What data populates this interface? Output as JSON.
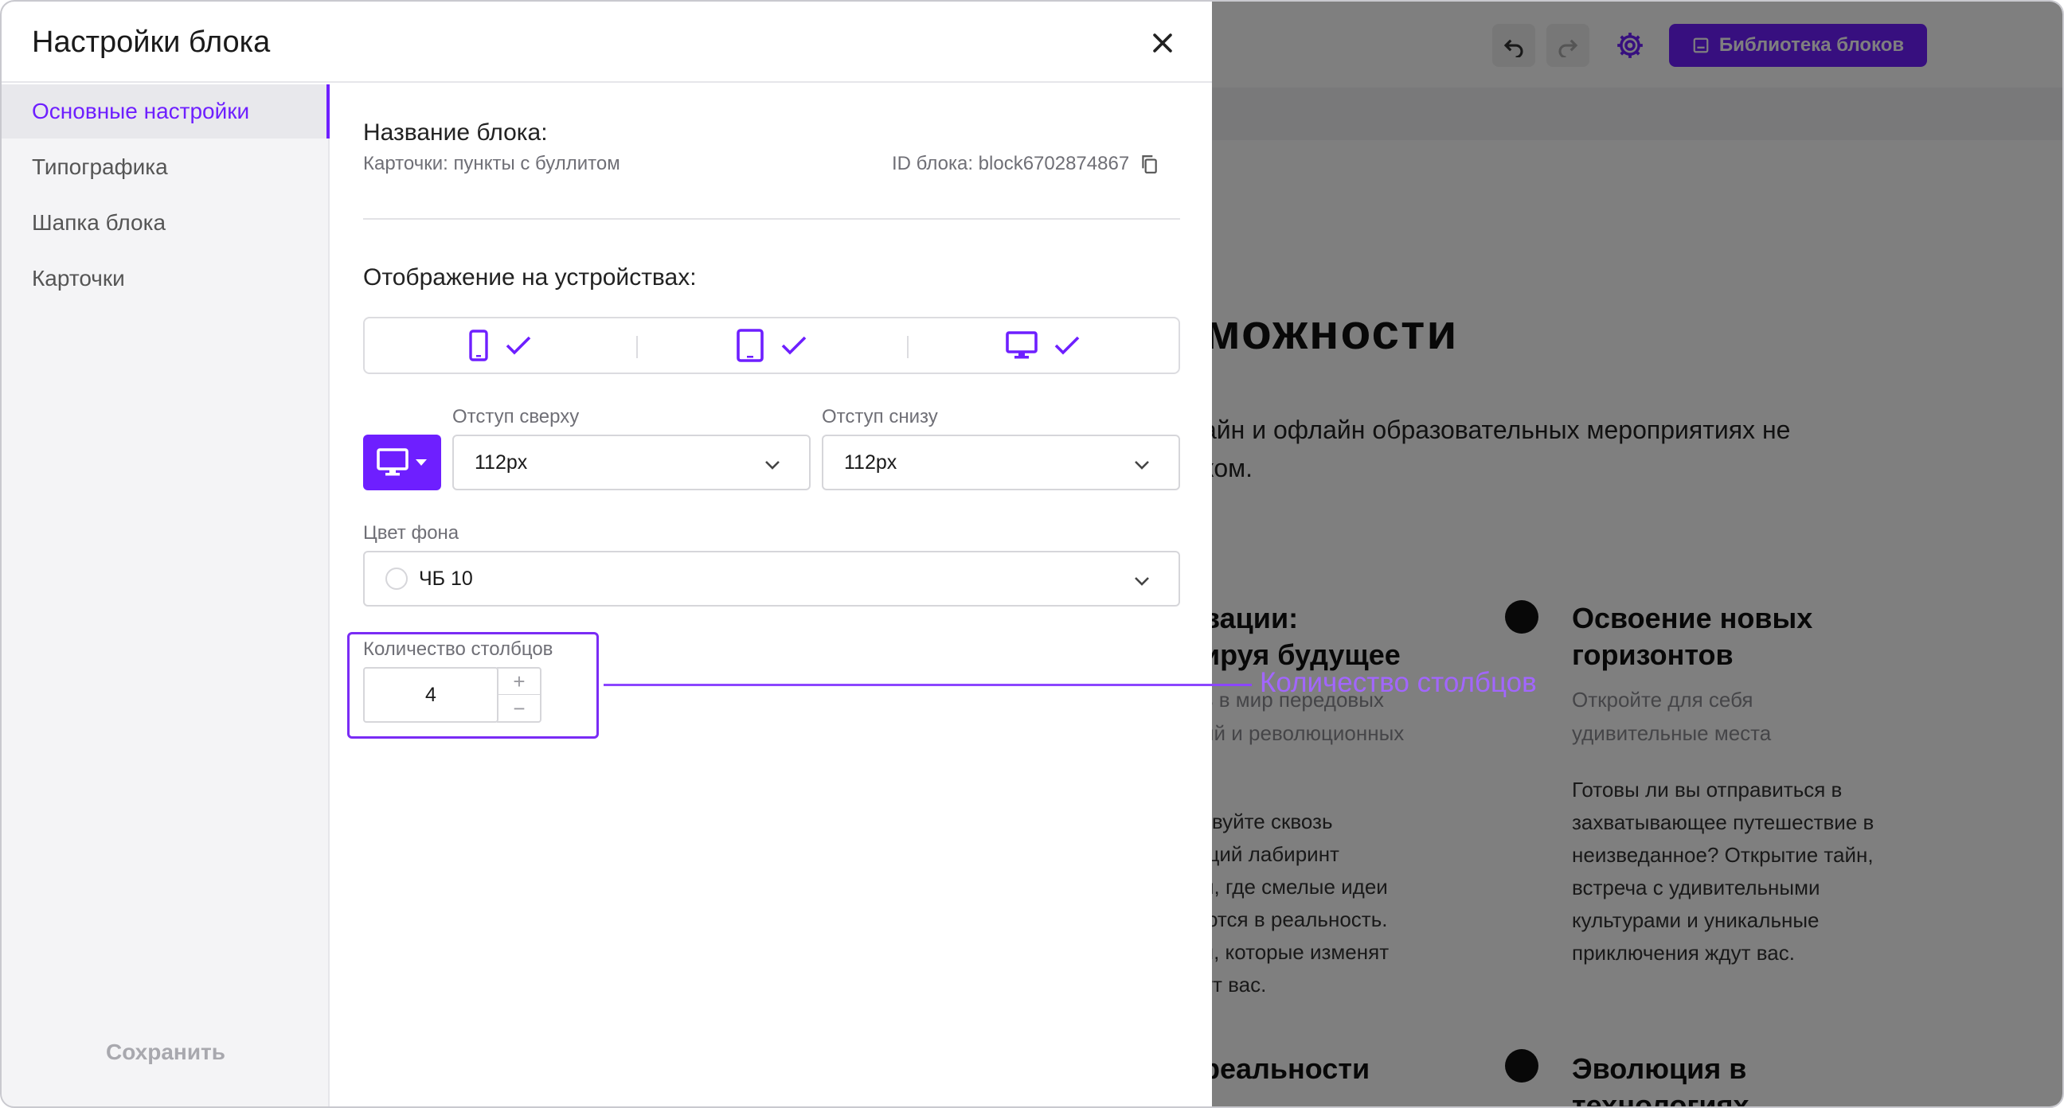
{
  "background_page": {
    "library_button_label": "Библиотека блоков",
    "heading_fragment": "можности",
    "description_line1": "айн и офлайн образовательных мероприятиях не",
    "description_line2": "ком.",
    "card_left": {
      "title_line1": "вации:",
      "title_line2": "ируя будущее",
      "sub_line1": "ь в мир передовых",
      "sub_line2": "ий и революционных",
      "body_lines": [
        "твуйте сквозь",
        "щий лабиринт",
        "й, где смелые идеи",
        "ются в реальность.",
        "я, которые изменят",
        "ут вас."
      ],
      "bottom_title": "реальности"
    },
    "card_right": {
      "title_line1": "Освоение новых",
      "title_line2": "горизонтов",
      "sub_line1": "Откройте для себя",
      "sub_line2": "удивительные места",
      "body_lines": [
        "Готовы ли вы отправиться в",
        "захватывающее путешествие в",
        "неизведанное? Открытие тайн,",
        "встреча с удивительными",
        "культурами и уникальные",
        "приключения ждут вас."
      ],
      "bottom_title_line1": "Эволюция в",
      "bottom_title_line2": "технологиях"
    }
  },
  "modal": {
    "title": "Настройки блока",
    "sidebar": {
      "items": [
        {
          "label": "Основные настройки",
          "active": true
        },
        {
          "label": "Типографика",
          "active": false
        },
        {
          "label": "Шапка блока",
          "active": false
        },
        {
          "label": "Карточки",
          "active": false
        }
      ],
      "save_label": "Сохранить"
    },
    "content": {
      "block_name_label": "Название блока:",
      "block_name_value": "Карточки: пункты с буллитом",
      "block_id_label": "ID блока: block6702874867",
      "devices_label": "Отображение на устройствах:",
      "devices": [
        {
          "icon": "phone-icon",
          "checked": true
        },
        {
          "icon": "tablet-icon",
          "checked": true
        },
        {
          "icon": "desktop-icon",
          "checked": true
        }
      ],
      "padding_top_label": "Отступ сверху",
      "padding_top_value": "112px",
      "padding_bottom_label": "Отступ снизу",
      "padding_bottom_value": "112px",
      "bg_color_label": "Цвет фона",
      "bg_color_value": "ЧБ 10",
      "columns_label": "Количество столбцов",
      "columns_value": "4",
      "step_plus": "+",
      "step_minus": "−"
    }
  },
  "annotation": {
    "label": "Количество столбцов"
  },
  "colors": {
    "accent": "#6e1fff",
    "annotation": "#a266ff",
    "overlay": "rgba(0,0,0,0.5)"
  }
}
